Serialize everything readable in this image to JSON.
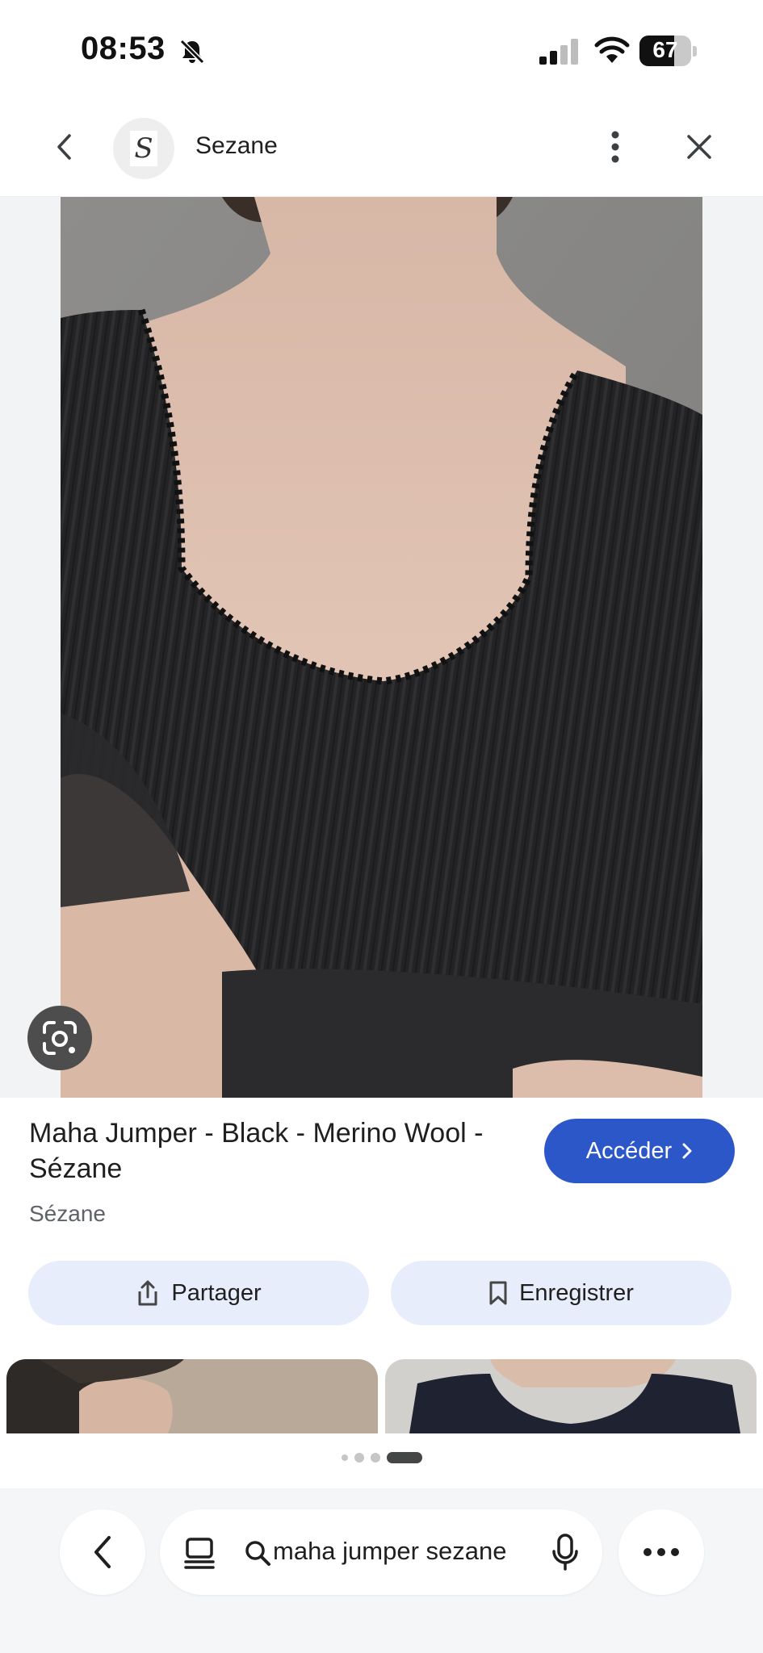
{
  "status_bar": {
    "time": "08:53",
    "battery_percent": "67",
    "battery_level": 0.67,
    "icons": [
      "bell-slash-icon",
      "cellular-signal-icon",
      "wifi-icon",
      "battery-icon"
    ]
  },
  "header": {
    "site_name": "Sezane",
    "logo_letter": "S",
    "icons": [
      "chevron-left-icon",
      "more-vertical-icon",
      "close-icon"
    ]
  },
  "product": {
    "title": "Maha Jumper - Black - Merino Wool - Sézane",
    "source": "Sézane",
    "visit_label": "Accéder"
  },
  "actions": {
    "share_label": "Partager",
    "save_label": "Enregistrer"
  },
  "search_bar": {
    "query": "maha jumper sezane"
  },
  "pagination": {
    "total_dots": 4,
    "active_index": 3
  },
  "colors": {
    "accent": "#2b57c9",
    "pill_background": "#e7edfb",
    "garment": "#222224",
    "backdrop": "#8a8987"
  }
}
